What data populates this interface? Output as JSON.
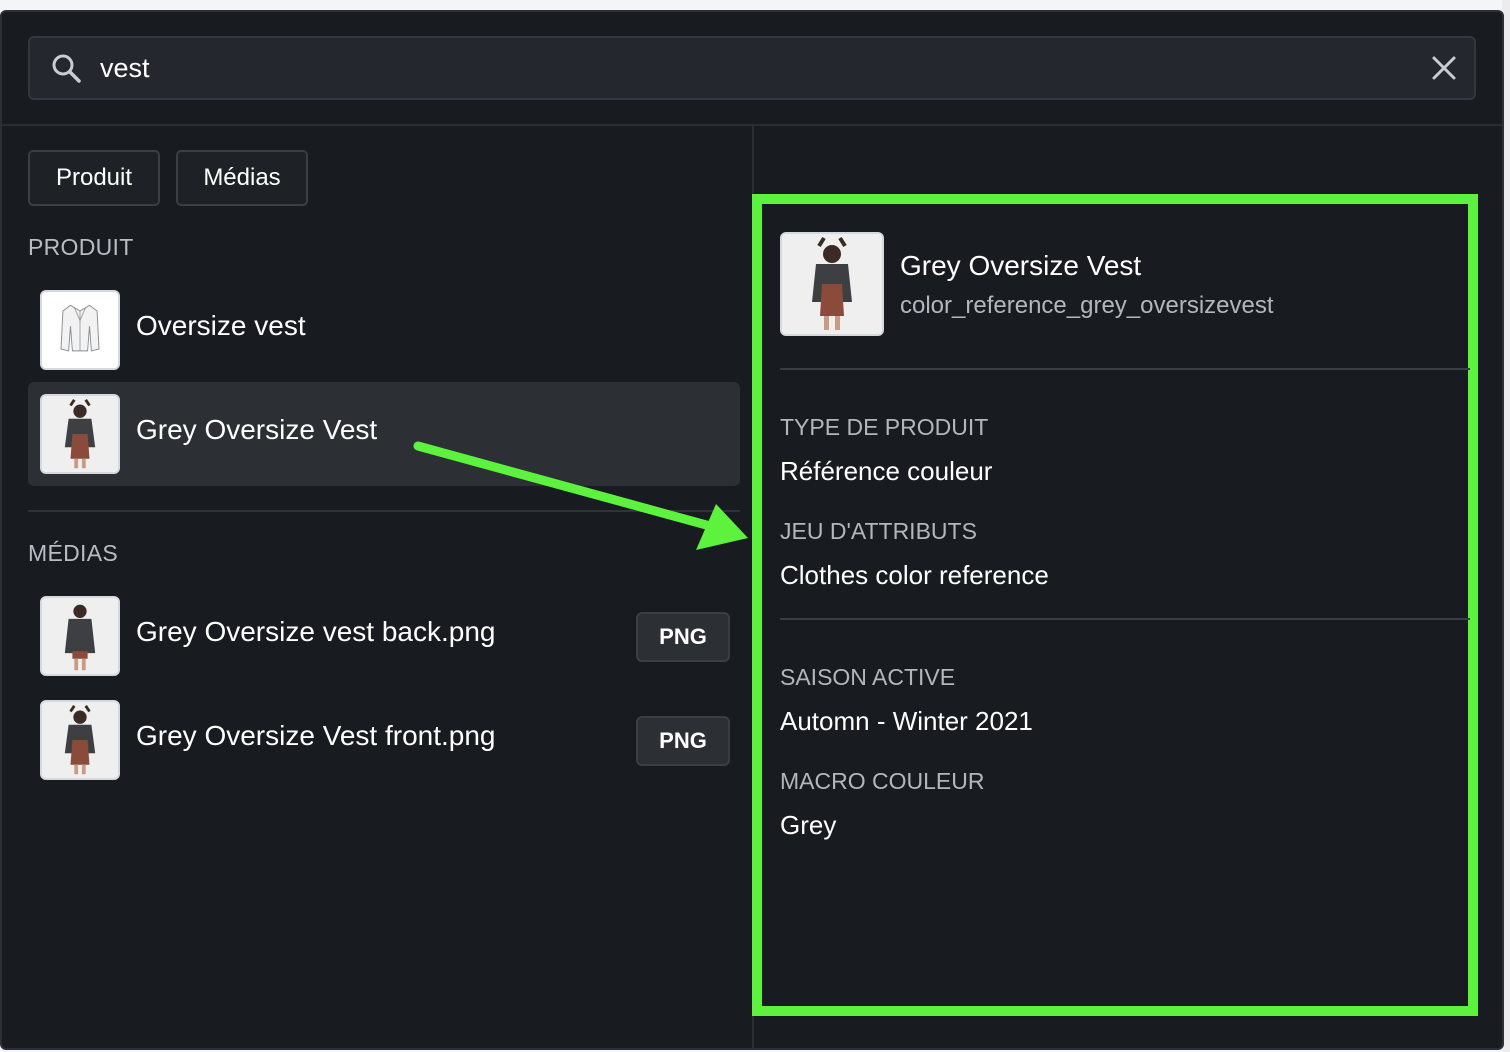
{
  "search": {
    "value": "vest",
    "icon": "search-icon",
    "clear_icon": "close-icon"
  },
  "filters": {
    "produit_label": "Produit",
    "medias_label": "Médias"
  },
  "produit_section": {
    "title": "PRODUIT",
    "items": [
      {
        "label": "Oversize vest",
        "thumb": "jacket-sketch"
      },
      {
        "label": "Grey Oversize Vest",
        "thumb": "model-photo"
      }
    ]
  },
  "medias_section": {
    "title": "MÉDIAS",
    "items": [
      {
        "label": "Grey Oversize vest back.png",
        "badge": "PNG"
      },
      {
        "label": "Grey Oversize Vest front.png",
        "badge": "PNG"
      }
    ]
  },
  "detail": {
    "title": "Grey Oversize Vest",
    "code": "color_reference_grey_oversizevest",
    "fields": [
      {
        "label": "TYPE DE PRODUIT",
        "value": "Référence couleur"
      },
      {
        "label": "JEU D'ATTRIBUTS",
        "value": "Clothes color reference"
      },
      {
        "label": "SAISON ACTIVE",
        "value": "Automn - Winter 2021"
      },
      {
        "label": "MACRO COULEUR",
        "value": "Grey"
      }
    ]
  },
  "colors": {
    "panel_bg": "#181b1f",
    "highlight": "#5cf23d",
    "selected_row": "#2c3035"
  }
}
